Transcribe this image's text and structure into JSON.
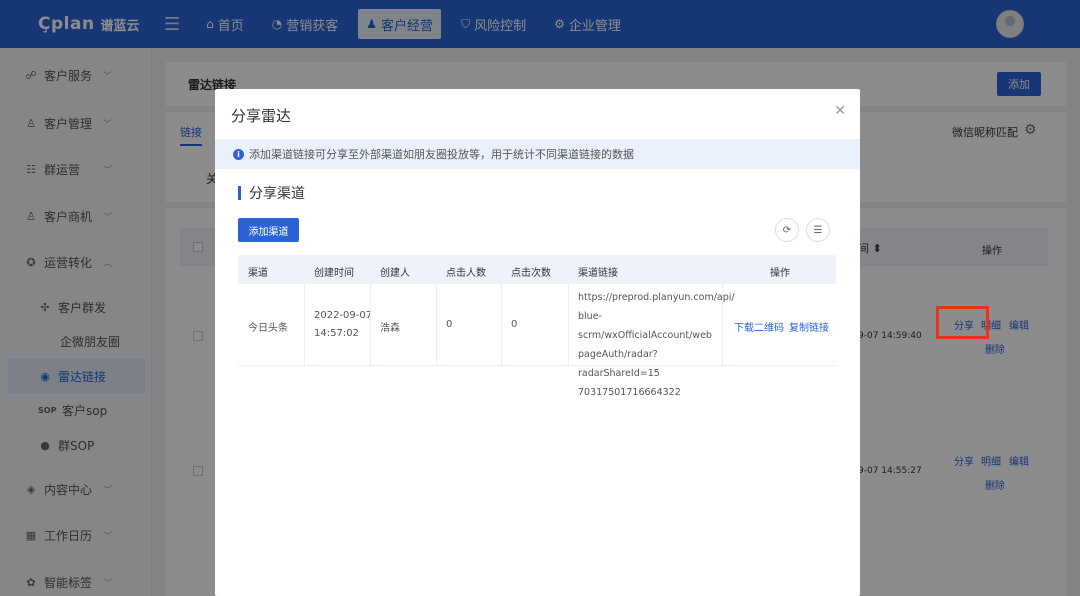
{
  "topbar": {
    "logo_mark": "Çplan",
    "logo_name": "谱蓝云",
    "nav": [
      {
        "label": "首页",
        "icon": "⌂"
      },
      {
        "label": "营销获客",
        "icon": "◔"
      },
      {
        "label": "客户经营",
        "icon": "♟"
      },
      {
        "label": "风险控制",
        "icon": "⛉"
      },
      {
        "label": "企业管理",
        "icon": "⚙"
      }
    ]
  },
  "sidebar": {
    "items": [
      {
        "label": "客户服务",
        "icon": "☍"
      },
      {
        "label": "客户管理",
        "icon": "♙"
      },
      {
        "label": "群运营",
        "icon": "☷"
      },
      {
        "label": "客户商机",
        "icon": "♙"
      },
      {
        "label": "运营转化",
        "icon": "✪"
      },
      {
        "label": "客户群发",
        "icon": "✣"
      },
      {
        "label": "企微朋友圈",
        "icon": ""
      },
      {
        "label": "雷达链接",
        "icon": "◉"
      },
      {
        "label": "客户sop",
        "icon": "SOP"
      },
      {
        "label": "群SOP",
        "icon": "●"
      },
      {
        "label": "内容中心",
        "icon": "◈"
      },
      {
        "label": "工作日历",
        "icon": "▦"
      },
      {
        "label": "智能标签",
        "icon": "✿"
      }
    ]
  },
  "background": {
    "title": "雷达链接",
    "add_button": "添加",
    "tab": "链接",
    "match_label": "微信昵称匹配",
    "keyword_prefix": "关",
    "col_time_suffix": "间",
    "col_op": "操作",
    "rows": [
      {
        "time": "9-07 14:59:40",
        "share": "分享",
        "detail": "明细",
        "edit": "编辑",
        "delete": "删除"
      },
      {
        "time": "9-07 14:55:27",
        "share": "分享",
        "detail": "明细",
        "edit": "编辑",
        "delete": "删除"
      }
    ]
  },
  "modal": {
    "title": "分享雷达",
    "notice": "添加渠道链接可分享至外部渠道如朋友圈投放等，用于统计不同渠道链接的数据",
    "section_title": "分享渠道",
    "add_channel_button": "添加渠道",
    "table": {
      "columns": [
        "渠道",
        "创建时间",
        "创建人",
        "点击人数",
        "点击次数",
        "渠道链接",
        "操作"
      ],
      "rows": [
        {
          "channel": "今日头条",
          "created_date": "2022-09-07",
          "created_time": "14:57:02",
          "creator": "浩森",
          "click_users": "0",
          "click_count": "0",
          "link_lines": [
            "https://preprod.planyun.com/api/",
            "blue-scrm/wxOfficialAccount/web",
            "pageAuth/radar?radarShareId=15",
            "70317501716664322"
          ],
          "op_download": "下载二维码",
          "op_copy": "复制链接"
        }
      ]
    }
  }
}
